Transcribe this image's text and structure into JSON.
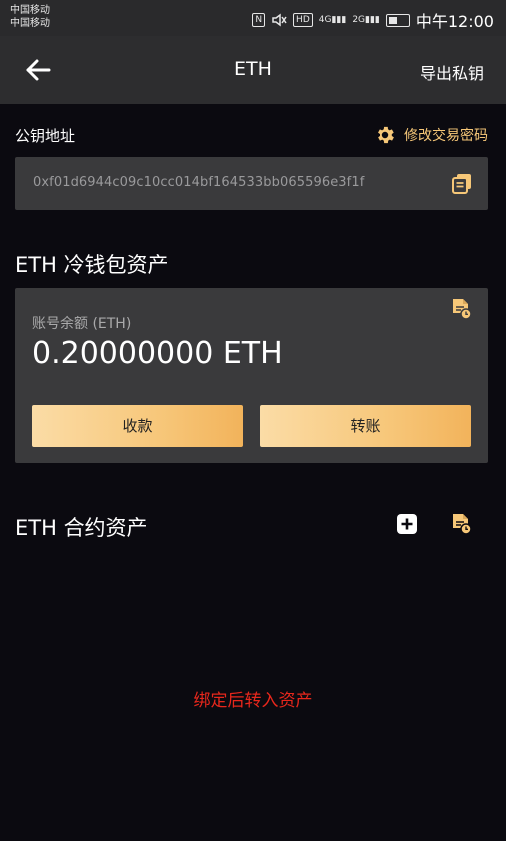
{
  "status_bar": {
    "carrier_1": "中国移动",
    "carrier_2": "中国移动",
    "nfc": "N",
    "hd": "HD",
    "signal_1": "4G",
    "signal_2": "2G",
    "time": "中午12:00"
  },
  "nav": {
    "title": "ETH",
    "export_label": "导出私钥",
    "back_icon": "arrow-left-icon"
  },
  "public_key": {
    "label": "公钥地址",
    "change_password_label": "修改交易密码",
    "address": "0xf01d6944c09c10cc014bf164533bb065596e3f1f"
  },
  "cold_wallet": {
    "title": "ETH 冷钱包资产",
    "balance_label": "账号余额 (ETH)",
    "balance_value": "0.20000000 ETH",
    "receive_label": "收款",
    "transfer_label": "转账"
  },
  "contract_assets": {
    "title": "ETH 合约资产",
    "empty_hint": "绑定后转入资产"
  },
  "colors": {
    "accent": "#f6c778",
    "background": "#0b0a10",
    "card": "#3a3a3c",
    "hint_red": "#e8271c"
  }
}
